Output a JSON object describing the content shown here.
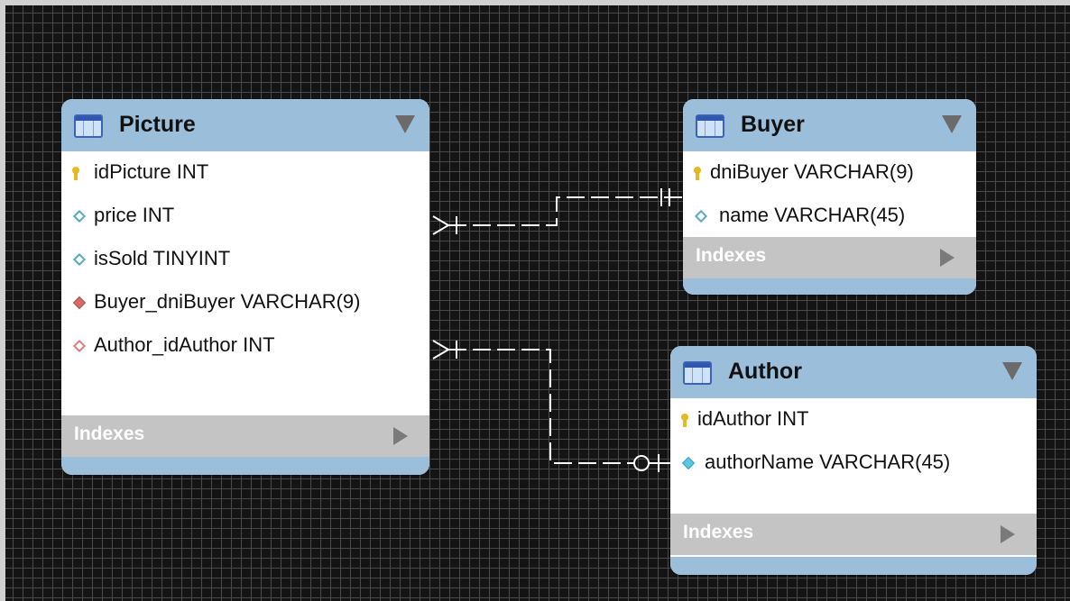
{
  "tables": {
    "picture": {
      "title": "Picture",
      "columns": [
        {
          "label": "idPicture INT",
          "icon": "primary-key-icon"
        },
        {
          "label": "price INT",
          "icon": "column-diamond-icon"
        },
        {
          "label": "isSold TINYINT",
          "icon": "column-diamond-icon"
        },
        {
          "label": "Buyer_dniBuyer VARCHAR(9)",
          "icon": "foreign-key-icon"
        },
        {
          "label": "Author_idAuthor INT",
          "icon": "foreign-key-icon"
        }
      ],
      "indexes_label": "Indexes"
    },
    "buyer": {
      "title": "Buyer",
      "columns": [
        {
          "label": "dniBuyer VARCHAR(9)",
          "icon": "primary-key-icon"
        },
        {
          "label": "name VARCHAR(45)",
          "icon": "column-diamond-icon"
        }
      ],
      "indexes_label": "Indexes"
    },
    "author": {
      "title": "Author",
      "columns": [
        {
          "label": "idAuthor INT",
          "icon": "primary-key-icon"
        },
        {
          "label": "authorName VARCHAR(45)",
          "icon": "column-diamond-icon"
        }
      ],
      "indexes_label": "Indexes"
    }
  },
  "colors": {
    "header": "#9bbfdb",
    "indexes_bar": "#c4c4c4",
    "canvas": "#141414",
    "grid": "#4a4a4a",
    "relationship_line": "#ffffff"
  }
}
